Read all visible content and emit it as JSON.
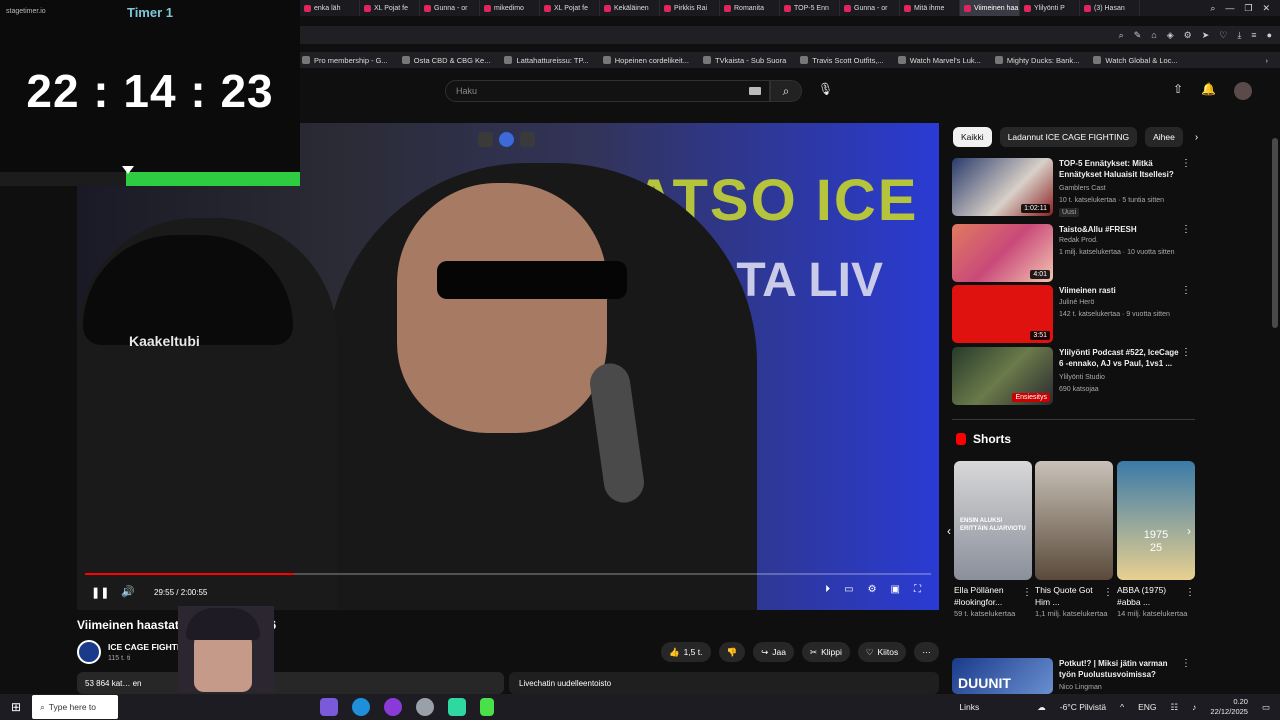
{
  "browser": {
    "tabs": [
      {
        "label": "enka läh"
      },
      {
        "label": "XL Pojat fe"
      },
      {
        "label": "Gunna - or"
      },
      {
        "label": "mikedimo"
      },
      {
        "label": "XL Pojat fe"
      },
      {
        "label": "Kekäläinen"
      },
      {
        "label": "Pirkkis Rai"
      },
      {
        "label": "Romanita"
      },
      {
        "label": "TOP-5 Enn"
      },
      {
        "label": "Gunna - or"
      },
      {
        "label": "Mitä ihme"
      },
      {
        "label": "Viimeinen haa"
      },
      {
        "label": "Ylilyönti P"
      },
      {
        "label": "(3) Hasan"
      }
    ],
    "bookmarks": [
      {
        "label": "Pro membership - G..."
      },
      {
        "label": "Osta CBD & CBG Ke..."
      },
      {
        "label": "Lattahattureissu: TP..."
      },
      {
        "label": "Hopeinen cordelikeit..."
      },
      {
        "label": "TVkaista - Sub Suora"
      },
      {
        "label": "Travis Scott Outfits,..."
      },
      {
        "label": "Watch Marvel's Luk..."
      },
      {
        "label": "Mighty Ducks: Bank..."
      },
      {
        "label": "Watch Global & Loc..."
      }
    ]
  },
  "timer": {
    "brand": "stagetimer.io",
    "title": "Timer 1",
    "time": "22 : 14 : 23",
    "progress": 0.58
  },
  "youtube": {
    "search_placeholder": "Haku",
    "player": {
      "overlay_text_1": "KATSO ICE C",
      "overlay_text_2": "OSTA LIV",
      "cap_text": "Kaakeltubi",
      "time_display": "29:55 / 2:00:55",
      "progress": 0.247
    },
    "video": {
      "title": "Viimeinen haastattel…                ICE CAGE 6",
      "channel": "ICE CAGE FIGHTIN",
      "subscribers": "115 t. ti",
      "like_count": "1,5 t.",
      "share_label": "Jaa",
      "clip_label": "Klippi",
      "thanks_label": "Kiitos",
      "views_text": "53 864 kat…                                                   en",
      "chat_replay": "Livechatin uudelleentoisto"
    },
    "chips": [
      "Kaikki",
      "Ladannut ICE CAGE FIGHTING",
      "Aihee"
    ],
    "recommendations": [
      {
        "title": "TOP-5 Ennätykset: Mitkä Ennätykset Haluaisit Itsellesi?",
        "channel": "Gamblers Cast",
        "meta": "10 t. katselukertaa · 5 tuntia sitten",
        "badge": "Uusi",
        "duration": "1:02:11"
      },
      {
        "title": "Taisto&Allu #FRESH",
        "channel": "Redak Prod.",
        "meta": "1 milj. katselukertaa · 10 vuotta sitten",
        "badge": "",
        "duration": "4:01"
      },
      {
        "title": "Viimeinen rasti",
        "channel": "Juliné Herö",
        "meta": "142 t. katselukertaa · 9 vuotta sitten",
        "badge": "",
        "duration": "3:51"
      },
      {
        "title": "Ylilyönti Podcast #522, IceCage 6 -ennako, AJ vs Paul, 1vs1 ...",
        "channel": "Ylilyönti Studio",
        "meta": "690 katsojaa",
        "badge": "",
        "duration": "Ensiesitys"
      }
    ],
    "shorts_header": "Shorts",
    "shorts": [
      {
        "title": "Ella Pöllänen #lookingfor...",
        "views": "59 t. katselukertaa",
        "thumb_text": "ENSIN ALUKSI ERITTÄIN ALIARVIOTU"
      },
      {
        "title": "This Quote Got Him ...",
        "views": "1,1 milj. katselukertaa",
        "thumb_text": ""
      },
      {
        "title": "ABBA (1975) #abba ...",
        "views": "14 milj. katselukertaa",
        "thumb_text": "1975\n25"
      }
    ],
    "last_rec": {
      "title": "Potkut!? | Miksi jätin varman työn Puolustusvoimissa?",
      "channel": "Nico Lingman",
      "thumb_text": "DUUNIT"
    }
  },
  "taskbar": {
    "search_placeholder": "Type here to",
    "links": "Links",
    "weather": "-6°C Pilvistä",
    "lang": "ENG",
    "time": "0.20",
    "date": "22/12/2025"
  },
  "colors": {
    "accent_red": "#ff0000",
    "timer_green": "#2ecc40",
    "timer_title": "#7fc8d8"
  }
}
